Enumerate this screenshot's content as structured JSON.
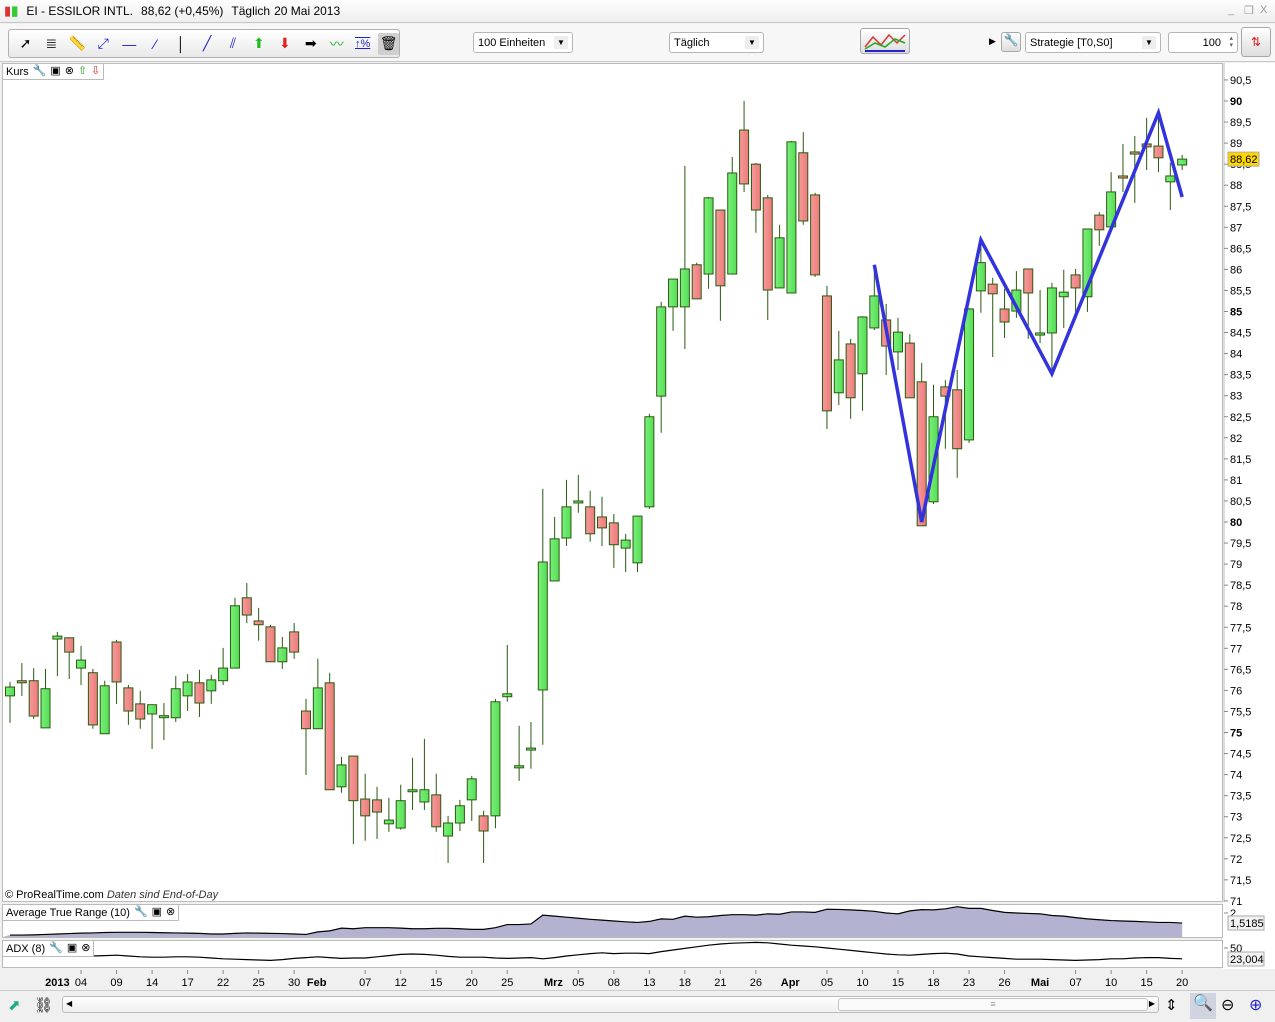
{
  "window": {
    "title": "EI - ESSILOR INTL.",
    "price_change": "88,62 (+0,45%)",
    "period": "Täglich",
    "date": "20 Mai 2013",
    "controls": [
      "_",
      "❐",
      "X"
    ]
  },
  "toolbar": {
    "tools": [
      "pointer-icon",
      "fibonacci-icon",
      "ruler-icon",
      "segment-icon",
      "horizontal-line-icon",
      "ray-icon",
      "vertical-line-icon",
      "trendline-icon",
      "parallel-channel-icon",
      "buy-arrow-icon",
      "sell-arrow-icon",
      "neutral-arrow-icon",
      "zigzag-icon",
      "percent-icon",
      "trash-icon"
    ],
    "units_select": "100 Einheiten",
    "period_select": "Täglich",
    "strategy_select": "Strategie [T0,S0]",
    "quantity": "100"
  },
  "panels": {
    "price": {
      "label": "Kurs"
    },
    "atr": {
      "label": "Average True Range (10)",
      "tick": "2",
      "value": "1,5185"
    },
    "adx": {
      "label": "ADX (8)",
      "tick": "50",
      "value": "23,004"
    }
  },
  "footer": {
    "copyright": "© ProRealTime.com",
    "note": "Daten sind End-of-Day"
  },
  "colors": {
    "up": "#55dd55",
    "down": "#ee7a7a",
    "outline": "#2a5a10",
    "zigzag": "#3333dd",
    "atr_fill": "#b3b3d1",
    "last_price": "#ffd700"
  },
  "chart_data": {
    "type": "candlestick",
    "title": "EI - ESSILOR INTL.",
    "ylim": [
      70.8,
      91
    ],
    "y_ticks": [
      71,
      71.5,
      72,
      72.5,
      73,
      73.5,
      74,
      74.5,
      75,
      75.5,
      76,
      76.5,
      77,
      77.5,
      78,
      78.5,
      79,
      79.5,
      80,
      80.5,
      81,
      81.5,
      82,
      82.5,
      83,
      83.5,
      84,
      84.5,
      85,
      85.5,
      86,
      86.5,
      87,
      87.5,
      88,
      88.5,
      89,
      89.5,
      90,
      90.5
    ],
    "last_price": "88,62",
    "ohlc": [
      [
        75.87,
        76.2,
        75.23,
        76.08
      ],
      [
        76.23,
        76.65,
        75.87,
        76.18
      ],
      [
        76.23,
        76.53,
        75.32,
        75.39
      ],
      [
        75.11,
        76.51,
        75.11,
        76.04
      ],
      [
        77.22,
        77.39,
        76.34,
        77.29
      ],
      [
        77.25,
        77.25,
        76.27,
        76.91
      ],
      [
        76.53,
        77.06,
        76.13,
        76.72
      ],
      [
        76.42,
        76.51,
        75.09,
        75.18
      ],
      [
        74.97,
        76.23,
        74.97,
        76.11
      ],
      [
        77.15,
        77.2,
        75.68,
        76.2
      ],
      [
        76.06,
        76.13,
        75.18,
        75.51
      ],
      [
        75.68,
        75.99,
        75.09,
        75.32
      ],
      [
        75.44,
        75.66,
        74.61,
        75.66
      ],
      [
        75.39,
        75.7,
        74.82,
        75.4
      ],
      [
        75.35,
        76.34,
        75.25,
        76.04
      ],
      [
        75.87,
        76.39,
        75.51,
        76.2
      ],
      [
        76.18,
        76.49,
        75.37,
        75.7
      ],
      [
        75.99,
        76.37,
        75.68,
        76.25
      ],
      [
        76.23,
        77.01,
        76.13,
        76.53
      ],
      [
        76.53,
        78.2,
        76.53,
        78.01
      ],
      [
        78.2,
        78.55,
        77.6,
        77.79
      ],
      [
        77.65,
        77.96,
        77.18,
        77.56
      ],
      [
        77.51,
        77.56,
        76.68,
        76.68
      ],
      [
        76.68,
        77.27,
        76.51,
        77.01
      ],
      [
        77.39,
        77.6,
        76.75,
        76.91
      ],
      [
        75.51,
        75.8,
        73.99,
        75.09
      ],
      [
        75.09,
        76.75,
        75.09,
        76.06
      ],
      [
        76.18,
        76.42,
        73.64,
        73.64
      ],
      [
        73.71,
        74.42,
        73.57,
        74.23
      ],
      [
        74.44,
        74.44,
        72.35,
        73.38
      ],
      [
        73.42,
        74.02,
        72.43,
        73.02
      ],
      [
        73.4,
        73.71,
        72.47,
        73.11
      ],
      [
        72.83,
        73.45,
        72.64,
        72.92
      ],
      [
        72.73,
        73.76,
        72.69,
        73.38
      ],
      [
        73.64,
        74.4,
        73.16,
        73.64
      ],
      [
        73.35,
        74.85,
        73.16,
        73.64
      ],
      [
        73.52,
        74.02,
        72.64,
        72.76
      ],
      [
        72.54,
        73.02,
        71.9,
        72.85
      ],
      [
        72.85,
        73.4,
        72.66,
        73.26
      ],
      [
        73.4,
        73.97,
        72.9,
        73.9
      ],
      [
        73.02,
        73.14,
        71.9,
        72.66
      ],
      [
        73.02,
        75.8,
        72.73,
        75.73
      ],
      [
        75.85,
        77.08,
        75.73,
        75.92
      ],
      [
        74.16,
        75.16,
        73.85,
        74.21
      ],
      [
        74.59,
        75.25,
        74.14,
        74.63
      ],
      [
        76.01,
        80.79,
        74.71,
        79.05
      ],
      [
        78.6,
        80.12,
        78.6,
        79.6
      ],
      [
        79.62,
        81.0,
        79.43,
        80.36
      ],
      [
        80.5,
        81.12,
        80.22,
        80.5
      ],
      [
        80.36,
        80.74,
        79.53,
        79.72
      ],
      [
        80.12,
        80.6,
        79.43,
        79.86
      ],
      [
        79.98,
        80.19,
        78.91,
        79.46
      ],
      [
        79.38,
        79.72,
        78.81,
        79.57
      ],
      [
        79.03,
        80.14,
        78.81,
        80.14
      ],
      [
        80.36,
        82.57,
        80.31,
        82.5
      ],
      [
        82.99,
        85.23,
        82.12,
        85.11
      ],
      [
        85.11,
        85.77,
        84.54,
        85.77
      ],
      [
        85.11,
        88.46,
        84.11,
        86.01
      ],
      [
        86.11,
        86.16,
        85.3,
        85.3
      ],
      [
        85.89,
        87.72,
        85.54,
        87.7
      ],
      [
        87.41,
        87.41,
        84.78,
        85.61
      ],
      [
        85.89,
        88.67,
        85.89,
        88.29
      ],
      [
        89.31,
        90.0,
        87.84,
        88.03
      ],
      [
        88.5,
        88.53,
        86.87,
        87.41
      ],
      [
        87.7,
        87.77,
        84.8,
        85.51
      ],
      [
        85.56,
        87.06,
        85.56,
        86.75
      ],
      [
        85.44,
        89.05,
        85.44,
        89.03
      ],
      [
        88.77,
        89.26,
        87.06,
        87.15
      ],
      [
        87.77,
        87.82,
        85.82,
        85.87
      ],
      [
        85.37,
        85.61,
        82.21,
        82.64
      ],
      [
        83.07,
        84.54,
        82.78,
        83.85
      ],
      [
        84.23,
        84.35,
        82.45,
        82.95
      ],
      [
        83.52,
        84.89,
        82.64,
        84.87
      ],
      [
        84.61,
        86.11,
        84.56,
        85.37
      ],
      [
        84.8,
        85.18,
        83.49,
        84.18
      ],
      [
        84.04,
        84.85,
        83.61,
        84.51
      ],
      [
        84.25,
        84.46,
        82.95,
        82.95
      ],
      [
        83.33,
        83.78,
        79.91,
        79.91
      ],
      [
        80.48,
        83.26,
        80.43,
        82.5
      ],
      [
        83.21,
        83.37,
        81.74,
        82.99
      ],
      [
        83.14,
        83.61,
        81.05,
        81.74
      ],
      [
        81.95,
        85.08,
        81.88,
        85.06
      ],
      [
        85.49,
        86.72,
        84.97,
        86.16
      ],
      [
        85.65,
        85.8,
        83.92,
        85.42
      ],
      [
        85.06,
        85.54,
        84.37,
        84.75
      ],
      [
        85.01,
        85.96,
        84.85,
        85.51
      ],
      [
        86.01,
        86.01,
        84.35,
        85.44
      ],
      [
        84.44,
        85.51,
        84.25,
        84.49
      ],
      [
        84.49,
        85.68,
        83.56,
        85.56
      ],
      [
        85.35,
        85.99,
        84.61,
        85.46
      ],
      [
        85.87,
        86.01,
        84.97,
        85.56
      ],
      [
        85.35,
        86.96,
        84.99,
        86.96
      ],
      [
        87.29,
        87.36,
        86.56,
        86.94
      ],
      [
        87.01,
        88.31,
        87.01,
        87.84
      ],
      [
        88.22,
        88.98,
        87.84,
        88.17
      ],
      [
        88.79,
        89.17,
        87.58,
        88.74
      ],
      [
        88.98,
        89.6,
        88.36,
        88.91
      ],
      [
        88.93,
        89.69,
        88.31,
        88.65
      ],
      [
        88.08,
        88.53,
        87.41,
        88.22
      ],
      [
        88.48,
        88.72,
        88.36,
        88.62
      ]
    ],
    "zigzag": [
      [
        73,
        86.11
      ],
      [
        77,
        80.0
      ],
      [
        82,
        86.7
      ],
      [
        88,
        83.52
      ],
      [
        97,
        89.72
      ],
      [
        99,
        87.72
      ]
    ],
    "atr": [
      0.95,
      0.95,
      0.96,
      0.98,
      1.0,
      1.02,
      1.04,
      1.05,
      1.07,
      1.08,
      1.08,
      1.08,
      1.07,
      1.06,
      1.05,
      1.04,
      1.03,
      1.0,
      1.0,
      1.03,
      1.05,
      1.04,
      1.03,
      1.02,
      1.0,
      0.98,
      1.1,
      1.15,
      1.28,
      1.25,
      1.3,
      1.3,
      1.3,
      1.28,
      1.25,
      1.25,
      1.27,
      1.27,
      1.25,
      1.22,
      1.22,
      1.3,
      1.45,
      1.45,
      1.48,
      1.9,
      1.85,
      1.8,
      1.75,
      1.7,
      1.66,
      1.62,
      1.58,
      1.55,
      1.6,
      1.72,
      1.7,
      1.85,
      1.8,
      1.82,
      1.88,
      1.92,
      1.92,
      1.9,
      1.96,
      1.94,
      2.05,
      2.05,
      2.03,
      2.18,
      2.17,
      2.15,
      2.12,
      2.08,
      2.0,
      1.96,
      2.1,
      2.16,
      2.15,
      2.2,
      2.3,
      2.22,
      2.22,
      2.12,
      2.03,
      2.0,
      1.98,
      1.96,
      1.88,
      1.85,
      1.78,
      1.72,
      1.68,
      1.64,
      1.62,
      1.6,
      1.58,
      1.55,
      1.55,
      1.52
    ],
    "adx": [
      40,
      39,
      38,
      36,
      34,
      32,
      31,
      30,
      31,
      32,
      30,
      28,
      27,
      27,
      28,
      28,
      27,
      25,
      23,
      22,
      21,
      20,
      19,
      21,
      24,
      26,
      28,
      26,
      24,
      25,
      25,
      28,
      31,
      34,
      35,
      34,
      32,
      29,
      27,
      27,
      27,
      25,
      24,
      25,
      26,
      23,
      26,
      30,
      33,
      36,
      38,
      36,
      37,
      37,
      36,
      41,
      45,
      49,
      53,
      57,
      60,
      62,
      63,
      64,
      63,
      60,
      57,
      55,
      53,
      50,
      47,
      44,
      41,
      38,
      35,
      33,
      32,
      34,
      36,
      37,
      35,
      30,
      28,
      26,
      24,
      22,
      22,
      22,
      21,
      20,
      19,
      20,
      21,
      23,
      23,
      25,
      26,
      26,
      24,
      23
    ],
    "x_labels": [
      {
        "i": 4,
        "t": "2013",
        "bold": true
      },
      {
        "i": 6,
        "t": "04"
      },
      {
        "i": 9,
        "t": "09"
      },
      {
        "i": 12,
        "t": "14"
      },
      {
        "i": 15,
        "t": "17"
      },
      {
        "i": 18,
        "t": "22"
      },
      {
        "i": 21,
        "t": "25"
      },
      {
        "i": 24,
        "t": "30"
      },
      {
        "i": 25.9,
        "t": "Feb",
        "bold": true
      },
      {
        "i": 30,
        "t": "07"
      },
      {
        "i": 33,
        "t": "12"
      },
      {
        "i": 36,
        "t": "15"
      },
      {
        "i": 39,
        "t": "20"
      },
      {
        "i": 42,
        "t": "25"
      },
      {
        "i": 45.9,
        "t": "Mrz",
        "bold": true
      },
      {
        "i": 48,
        "t": "05"
      },
      {
        "i": 51,
        "t": "08"
      },
      {
        "i": 54,
        "t": "13"
      },
      {
        "i": 57,
        "t": "18"
      },
      {
        "i": 60,
        "t": "21"
      },
      {
        "i": 63,
        "t": "26"
      },
      {
        "i": 65.9,
        "t": "Apr",
        "bold": true
      },
      {
        "i": 69,
        "t": "05"
      },
      {
        "i": 72,
        "t": "10"
      },
      {
        "i": 75,
        "t": "15"
      },
      {
        "i": 78,
        "t": "18"
      },
      {
        "i": 81,
        "t": "23"
      },
      {
        "i": 84,
        "t": "26"
      },
      {
        "i": 87,
        "t": "Mai",
        "bold": true
      },
      {
        "i": 90,
        "t": "07"
      },
      {
        "i": 93,
        "t": "10"
      },
      {
        "i": 96,
        "t": "15"
      },
      {
        "i": 99,
        "t": "20"
      }
    ]
  }
}
